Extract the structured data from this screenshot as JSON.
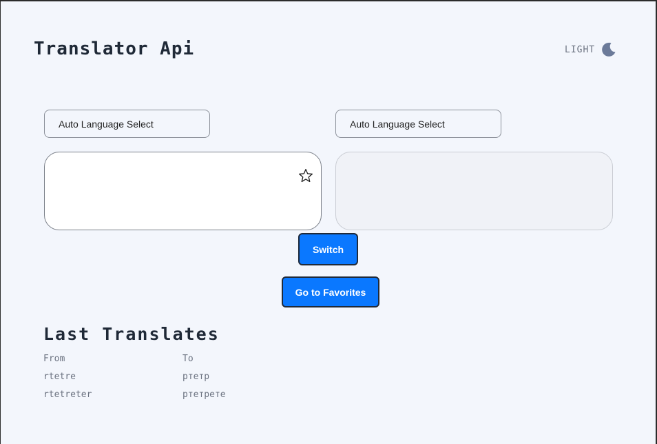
{
  "header": {
    "title": "Translator Api",
    "theme_label": "LIGHT",
    "theme_icon": "moon-icon"
  },
  "source": {
    "language_select": "Auto Language Select",
    "text": "",
    "favorite_icon": "star-icon"
  },
  "target": {
    "language_select": "Auto Language Select",
    "text": ""
  },
  "buttons": {
    "switch": "Switch",
    "favorites": "Go to Favorites"
  },
  "history": {
    "title": "Last Translates",
    "columns": [
      "From",
      "To"
    ],
    "rows": [
      [
        "rtetre",
        "ртетр"
      ],
      [
        "rtetreter",
        "ртетрете"
      ]
    ]
  },
  "colors": {
    "accent": "#0a78ff",
    "background": "#f3f6fc",
    "heading": "#1f2937",
    "muted": "#6b7280"
  }
}
